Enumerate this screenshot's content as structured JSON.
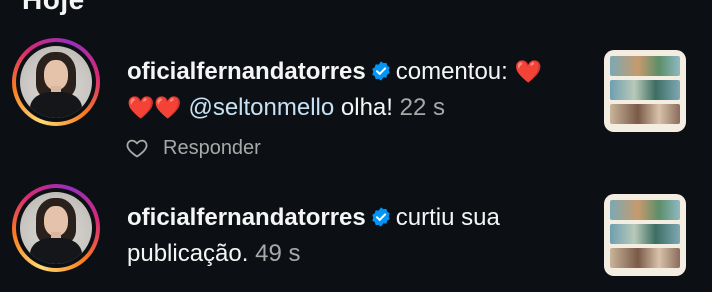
{
  "header": {
    "title": "Hoje"
  },
  "notifications": [
    {
      "username": "oficialfernandatorres",
      "action": "comentou:",
      "hearts_line1": "❤️",
      "hearts_line2": "❤️❤️",
      "mention": "@seltonmello",
      "comment": "olha!",
      "time": "22 s",
      "reply_label": "Responder"
    },
    {
      "username": "oficialfernandatorres",
      "action": "curtiu sua",
      "action_line2": "publicação.",
      "time": "49 s"
    }
  ],
  "colors": {
    "background": "#0c1014",
    "text": "#f5f5f5",
    "secondary_text": "#a8a8a8",
    "verified_badge": "#0095f6",
    "heart": "#ed1c24"
  }
}
